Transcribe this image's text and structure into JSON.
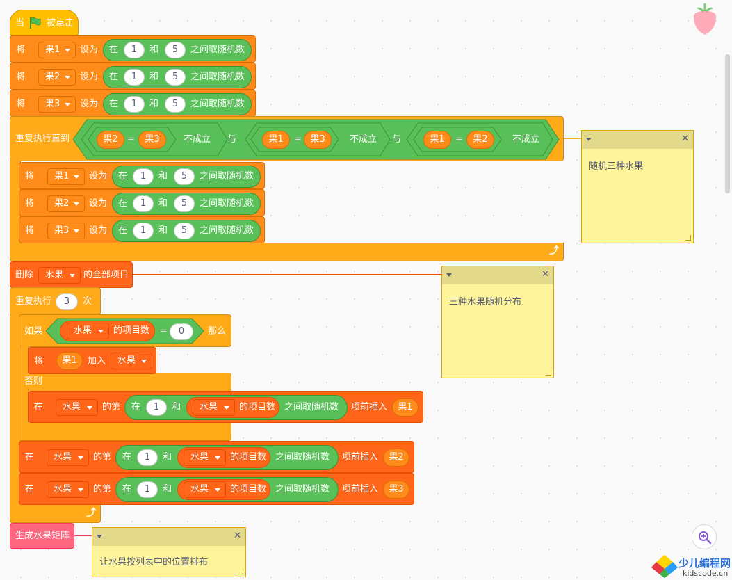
{
  "hat": {
    "when": "当",
    "clicked": "被点击"
  },
  "block_labels": {
    "set": "将",
    "to": "设为",
    "rand_in": "在",
    "and": "和",
    "rand_between": "之间取随机数",
    "repeat_until": "重复执行直到",
    "not_true": "不成立",
    "logic_and": "与",
    "eq": "=",
    "delete": "删除",
    "delete_all": "的全部项目",
    "repeat": "重复执行",
    "times": "次",
    "if": "如果",
    "length_of": "的项目数",
    "then": "那么",
    "add": "加入",
    "else": "否则",
    "insert_at": "在",
    "nth": "的第",
    "insert_before": "项前插入",
    "make_matrix": "生成水果矩阵"
  },
  "variables": {
    "v1": "果1",
    "v2": "果2",
    "v3": "果3",
    "list": "水果"
  },
  "numbers": {
    "min": "1",
    "max": "5",
    "repeat": "3",
    "zero": "0"
  },
  "comments": {
    "c1": "随机三种水果",
    "c2": "三种水果随机分布",
    "c3": "让水果按列表中的位置排布",
    "close": "✕"
  },
  "colors": {
    "events": "#ffbf00",
    "control": "#ffab19",
    "variables": "#ff8c1a",
    "lists": "#ff661a",
    "operators": "#59c059",
    "my_blocks": "#ff6680",
    "comment": "#fef49c"
  },
  "icons": {
    "flag": "green-flag-icon",
    "zoom": "zoom-in-icon",
    "sprite": "strawberry-icon",
    "logo": "kidscode-logo"
  },
  "watermark": {
    "brand": "少儿编程网",
    "url": "kidscode.cn"
  }
}
